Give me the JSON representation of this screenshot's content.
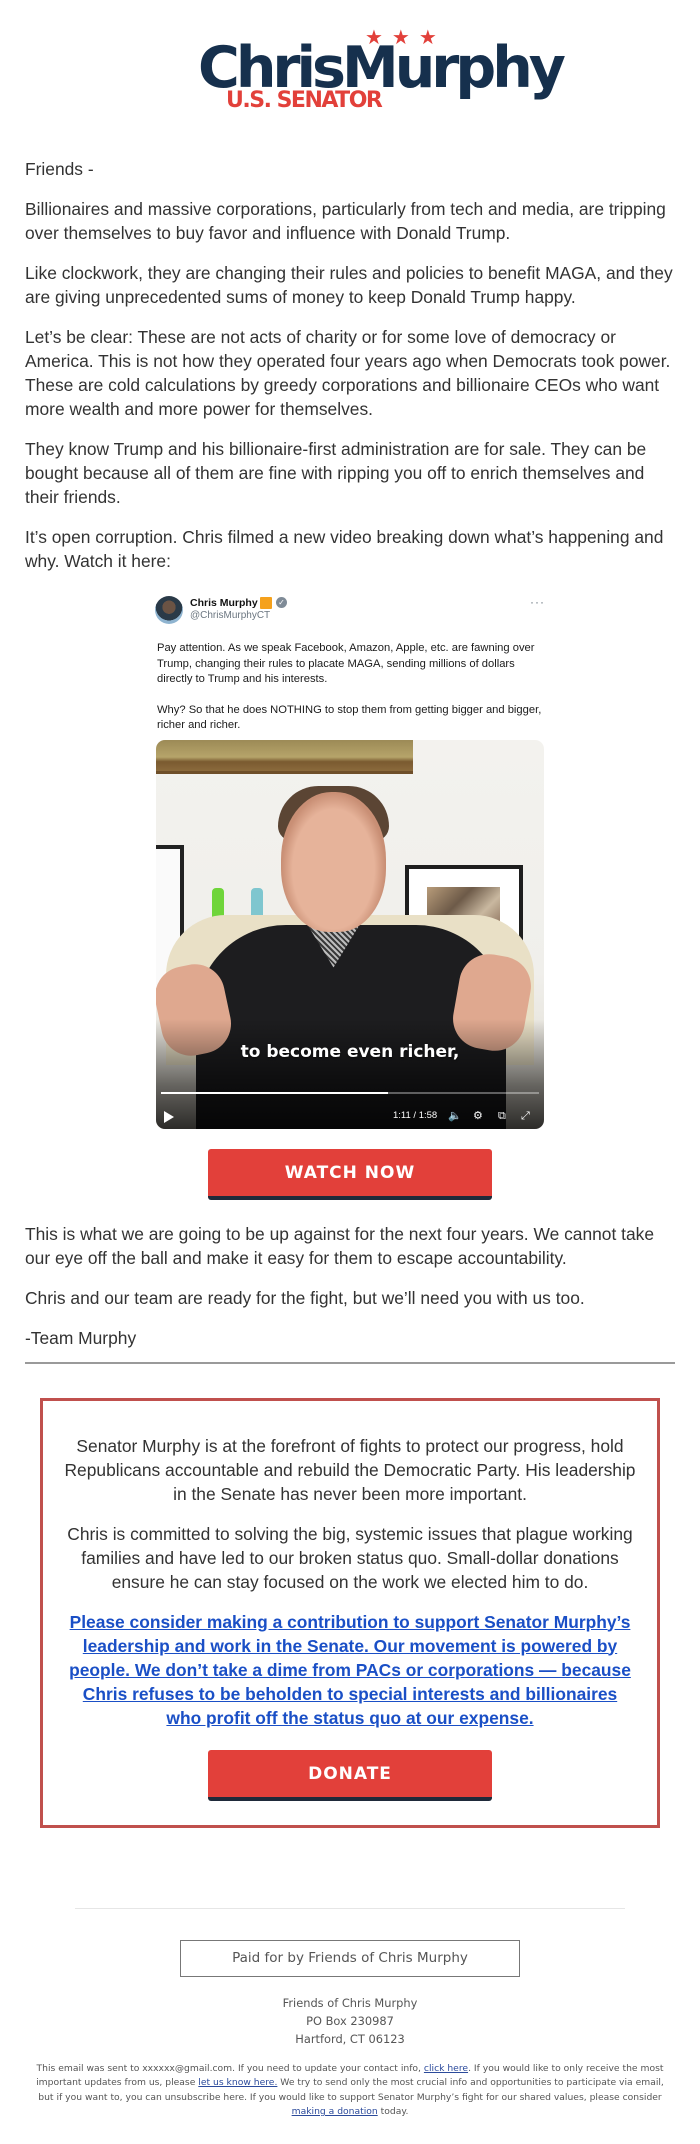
{
  "logo": {
    "stars": "★★★",
    "name": "ChrisMurphy",
    "subtitle": "U.S. SENATOR",
    "colors": {
      "navy": "#16304d",
      "red": "#e2403a"
    }
  },
  "intro": {
    "greeting": "Friends -",
    "paragraphs": [
      "Billionaires and massive corporations, particularly from tech and media, are tripping over themselves to buy favor and influence with Donald Trump.",
      "Like clockwork, they are changing their rules and policies to benefit MAGA, and they are giving unprecedented sums of money to keep Donald Trump happy.",
      "Let’s be clear: These are not acts of charity or for some love of democracy or America. This is not how they operated four years ago when Democrats took power. These are cold calculations by greedy corporations and billionaire CEOs who want more wealth and more power for themselves.",
      "They know Trump and his billionaire-first administration are for sale. They can be bought because all of them are fine with ripping you off to enrich themselves and their friends.",
      "It’s open corruption. Chris filmed a new video breaking down what’s happening and why. Watch it here:"
    ]
  },
  "tweet": {
    "author_name": "Chris Murphy",
    "handle": "@ChrisMurphyCT",
    "more_icon": "···",
    "verified_icon": "✓",
    "text_paragraphs": [
      "Pay attention. As we speak Facebook, Amazon, Apple, etc. are fawning over Trump, changing their rules to placate MAGA, sending millions of dollars directly to Trump and his interests.",
      "Why? So that he does NOTHING to stop them from getting bigger and bigger, richer and richer."
    ],
    "video": {
      "caption": "to become even richer,",
      "time": "1:11 / 1:58",
      "progress_fraction": 0.6,
      "icons": {
        "volume": "🔈",
        "settings": "⚙",
        "pip": "⧉",
        "fullscreen": "⤢"
      }
    }
  },
  "watch_button": {
    "label": "WATCH NOW"
  },
  "closing": {
    "paragraphs": [
      "This is what we are going to be up against for the next four years. We cannot take our eye off the ball and make it easy for them to escape accountability.",
      "Chris and our team are ready for the fight, but we’ll need you with us too."
    ],
    "signature": "-Team Murphy"
  },
  "donate_box": {
    "paragraphs": [
      "Senator Murphy is at the forefront of fights to protect our progress, hold Republicans accountable and rebuild the Democratic Party. His leadership in the Senate has never been more important.",
      "Chris is committed to solving the big, systemic issues that plague working families and have led to our broken status quo. Small-dollar donations ensure he can stay focused on the work we elected him to do."
    ],
    "appeal_link": "Please consider making a contribution to support Senator Murphy’s leadership and work in the Senate. Our movement is powered by people. We don’t take a dime from PACs or corporations — because Chris refuses to be beholden to special interests and billionaires who profit off the status quo at our expense.",
    "button_label": "DONATE",
    "border_color": "#c0504d"
  },
  "footer": {
    "paid_for": "Paid for by Friends of Chris Murphy",
    "address": [
      "Friends of Chris Murphy",
      "PO Box 230987",
      "Hartford, CT 06123"
    ],
    "fine_print": {
      "p1": "This email was sent to xxxxxx@gmail.com. If you need to update your contact info, ",
      "link1": "click here",
      "p2": ". If you would like to only receive the most important updates from us, please ",
      "link2": "let us know here.",
      "p3": " We try to send only the most crucial info and opportunities to participate via email, but if you want to, you can unsubscribe here. If you would like to support Senator Murphy’s fight for our shared values, please consider ",
      "link3": "making a donation",
      "p4": " today."
    }
  }
}
